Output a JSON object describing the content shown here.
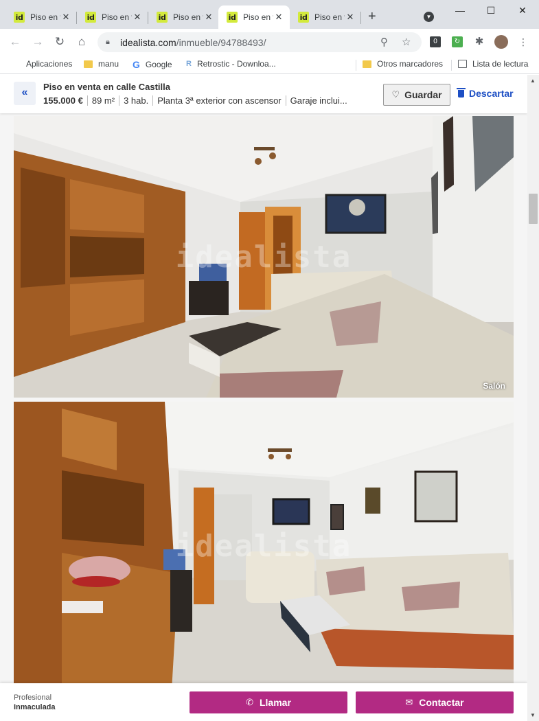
{
  "tabs": [
    {
      "icon": "id",
      "title": "Piso en venta en calle Castilla",
      "active": false
    },
    {
      "icon": "id",
      "title": "Piso en venta en calle Castilla",
      "active": false
    },
    {
      "icon": "id",
      "title": "Piso en venta en calle Castilla",
      "active": false
    },
    {
      "icon": "id",
      "title": "Piso en venta en calle Castilla",
      "active": true
    },
    {
      "icon": "id",
      "title": "Piso en venta en calle Castilla",
      "active": false
    }
  ],
  "toolbar": {
    "url_host": "idealista.com",
    "url_path": "/inmueble/94788493/"
  },
  "bookmarks": {
    "apps": "Aplicaciones",
    "manu": "manu",
    "google": "Google",
    "retrostic": "Retrostic - Downloa...",
    "others": "Otros marcadores",
    "reading_list": "Lista de lectura"
  },
  "listing": {
    "title": "Piso en venta en calle Castilla",
    "price": "155.000 €",
    "area": "89 m²",
    "rooms": "3 hab.",
    "floor": "Planta 3ª exterior con ascensor",
    "garage": "Garaje inclui...",
    "save_label": "Guardar",
    "discard_label": "Descartar"
  },
  "photos": {
    "watermark": "idealista",
    "photo1_caption": "Salón"
  },
  "footer": {
    "advertiser_type": "Profesional",
    "advertiser_name": "Inmaculada",
    "call_label": "Llamar",
    "contact_label": "Contactar"
  },
  "colors": {
    "accent_blue": "#1d4fc4",
    "cta_magenta": "#b22a83",
    "favicon_green": "#d3ea3c"
  }
}
